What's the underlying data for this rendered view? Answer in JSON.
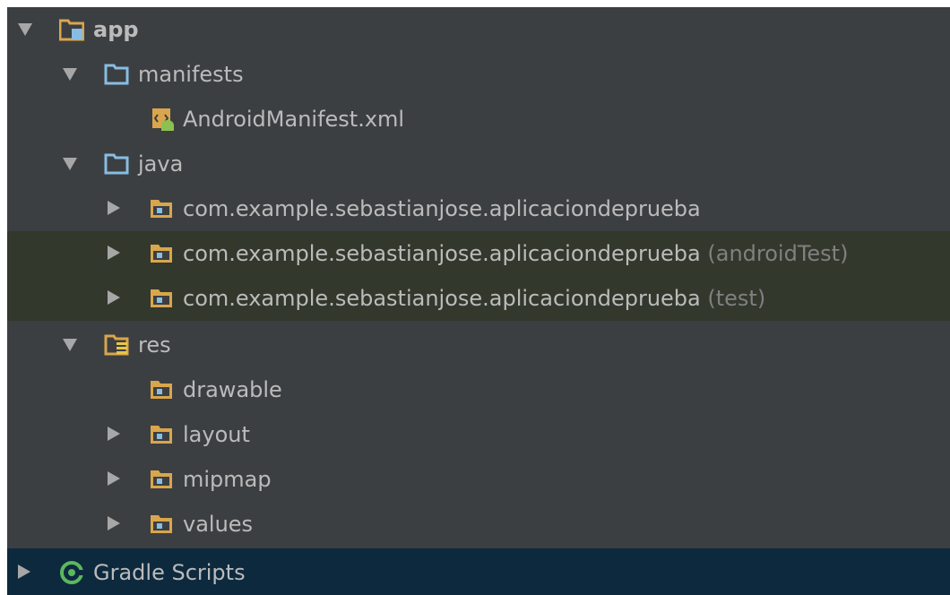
{
  "tree": {
    "app": {
      "label": "app",
      "icon": "app-module-folder-icon"
    },
    "manifests": {
      "label": "manifests",
      "icon": "folder-icon"
    },
    "android_manifest": {
      "label": "AndroidManifest.xml",
      "icon": "android-xml-file-icon"
    },
    "java": {
      "label": "java",
      "icon": "folder-icon"
    },
    "package_main": {
      "label": "com.example.sebastianjose.aplicaciondeprueba",
      "suffix": "",
      "icon": "package-icon"
    },
    "package_android_test": {
      "label": "com.example.sebastianjose.aplicaciondeprueba",
      "suffix": "(androidTest)",
      "icon": "package-icon"
    },
    "package_test": {
      "label": "com.example.sebastianjose.aplicaciondeprueba",
      "suffix": "(test)",
      "icon": "package-icon"
    },
    "res": {
      "label": "res",
      "icon": "resources-folder-icon"
    },
    "drawable": {
      "label": "drawable",
      "icon": "package-icon"
    },
    "layout": {
      "label": "layout",
      "icon": "package-icon"
    },
    "mipmap": {
      "label": "mipmap",
      "icon": "package-icon"
    },
    "values": {
      "label": "values",
      "icon": "package-icon"
    },
    "gradle_scripts": {
      "label": "Gradle Scripts",
      "icon": "gradle-icon"
    }
  },
  "colors": {
    "panel_bg": "#3c3f41",
    "text": "#bbbbbb",
    "suffix": "#808080",
    "highlight_row": "#32382c",
    "selected_row": "#0d293e",
    "folder_blue": "#87bde3",
    "package_orange": "#d9a64d",
    "gradle_green": "#5bb85d"
  }
}
